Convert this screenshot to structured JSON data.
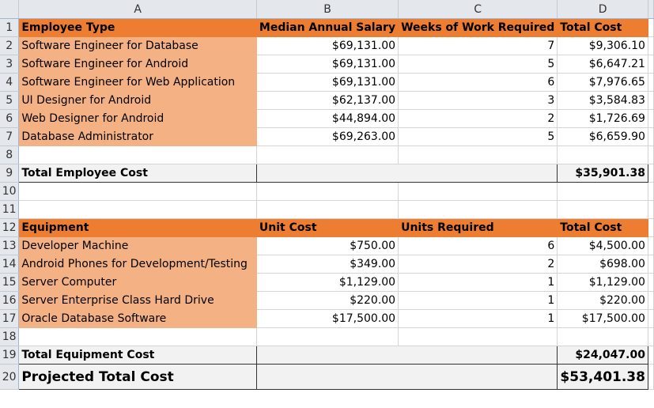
{
  "columns": [
    "A",
    "B",
    "C",
    "D"
  ],
  "employee": {
    "header": [
      "Employee Type",
      "Median Annual Salary",
      "Weeks of Work Required",
      "Total Cost"
    ],
    "rows": [
      [
        "Software Engineer for Database",
        "$69,131.00",
        "7",
        "$9,306.10"
      ],
      [
        "Software Engineer for Android",
        "$69,131.00",
        "5",
        "$6,647.21"
      ],
      [
        "Software Engineer for Web Application",
        "$69,131.00",
        "6",
        "$7,976.65"
      ],
      [
        "UI Designer for Android",
        "$62,137.00",
        "3",
        "$3,584.83"
      ],
      [
        "Web Designer for Android",
        "$44,894.00",
        "2",
        "$1,726.69"
      ],
      [
        "Database Administrator",
        "$69,263.00",
        "5",
        "$6,659.90"
      ]
    ],
    "total_label": "Total Employee Cost",
    "total": "$35,901.38"
  },
  "equipment": {
    "header": [
      "Equipment",
      "Unit Cost",
      "Units Required",
      "Total Cost"
    ],
    "rows": [
      [
        "Developer Machine",
        "$750.00",
        "6",
        "$4,500.00"
      ],
      [
        "Android Phones for Development/Testing",
        "$349.00",
        "2",
        "$698.00"
      ],
      [
        "Server Computer",
        "$1,129.00",
        "1",
        "$1,129.00"
      ],
      [
        "Server Enterprise Class Hard Drive",
        "$220.00",
        "1",
        "$220.00"
      ],
      [
        "Oracle Database Software",
        "$17,500.00",
        "1",
        "$17,500.00"
      ]
    ],
    "total_label": "Total Equipment Cost",
    "total": "$24,047.00"
  },
  "projected": {
    "label": "Projected Total Cost",
    "total": "$53,401.38"
  },
  "colors": {
    "header": "#ed7d31",
    "label_fill": "#f4b183",
    "total_fill": "#f2f2f2"
  }
}
